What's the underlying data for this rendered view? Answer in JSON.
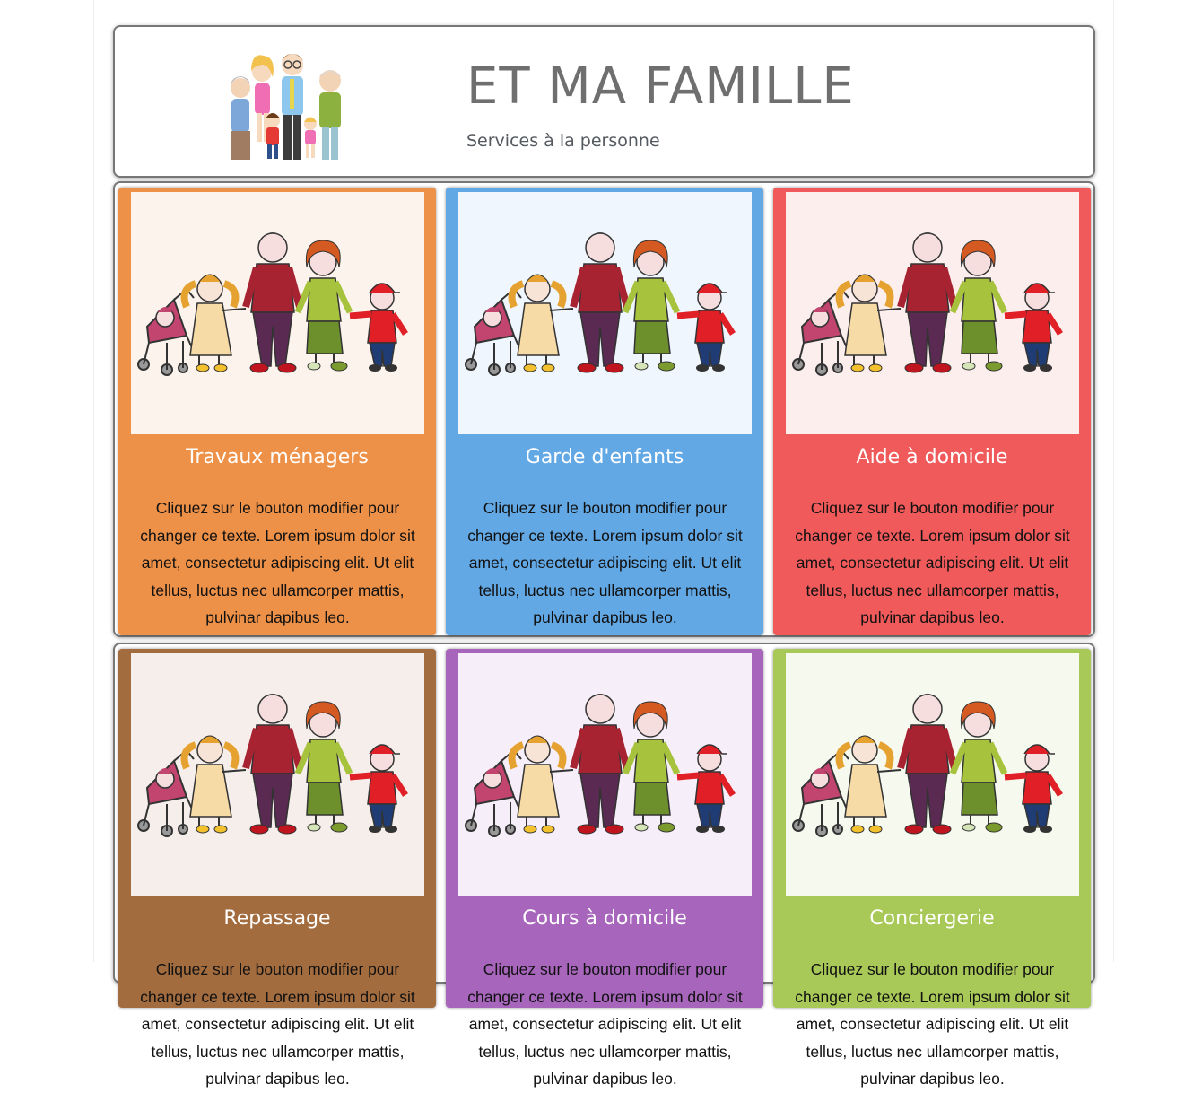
{
  "header": {
    "title": "ET MA FAMILLE",
    "subtitle": "Services à la personne",
    "logo_icon": "family-group-illustration"
  },
  "services": [
    {
      "title": "Travaux ménagers",
      "text": "Cliquez sur le bouton modifier pour changer ce texte. Lorem ipsum dolor sit amet, consectetur adipiscing elit. Ut elit tellus, luctus nec ullamcorper mattis, pulvinar dapibus leo.",
      "color": "#EE9148",
      "tint": "#FCF4EC",
      "image": "family-cartoon-illustration"
    },
    {
      "title": "Garde d'enfants",
      "text": "Cliquez sur le bouton modifier pour changer ce texte. Lorem ipsum dolor sit amet, consectetur adipiscing elit. Ut elit tellus, luctus nec ullamcorper mattis, pulvinar dapibus leo.",
      "color": "#62A8E5",
      "tint": "#EFF6FD",
      "image": "family-cartoon-illustration"
    },
    {
      "title": "Aide à domicile",
      "text": "Cliquez sur le bouton modifier pour changer ce texte. Lorem ipsum dolor sit amet, consectetur adipiscing elit. Ut elit tellus, luctus nec ullamcorper mattis, pulvinar dapibus leo.",
      "color": "#F05A5A",
      "tint": "#FDEEEE",
      "image": "family-cartoon-illustration"
    },
    {
      "title": "Repassage",
      "text": "Cliquez sur le bouton modifier pour changer ce texte. Lorem ipsum dolor sit amet, consectetur adipiscing elit. Ut elit tellus, luctus nec ullamcorper mattis, pulvinar dapibus leo.",
      "color": "#A36C3F",
      "tint": "#F5EEEA",
      "image": "family-cartoon-illustration"
    },
    {
      "title": "Cours à domicile",
      "text": "Cliquez sur le bouton modifier pour changer ce texte. Lorem ipsum dolor sit amet, consectetur adipiscing elit. Ut elit tellus, luctus nec ullamcorper mattis, pulvinar dapibus leo.",
      "color": "#A765BC",
      "tint": "#F6EEF8",
      "image": "family-cartoon-illustration"
    },
    {
      "title": "Conciergerie",
      "text": "Cliquez sur le bouton modifier pour changer ce texte. Lorem ipsum dolor sit amet, consectetur adipiscing elit. Ut elit tellus, luctus nec ullamcorper mattis, pulvinar dapibus leo.",
      "color": "#A8C957",
      "tint": "#F5F9EE",
      "image": "family-cartoon-illustration"
    }
  ]
}
